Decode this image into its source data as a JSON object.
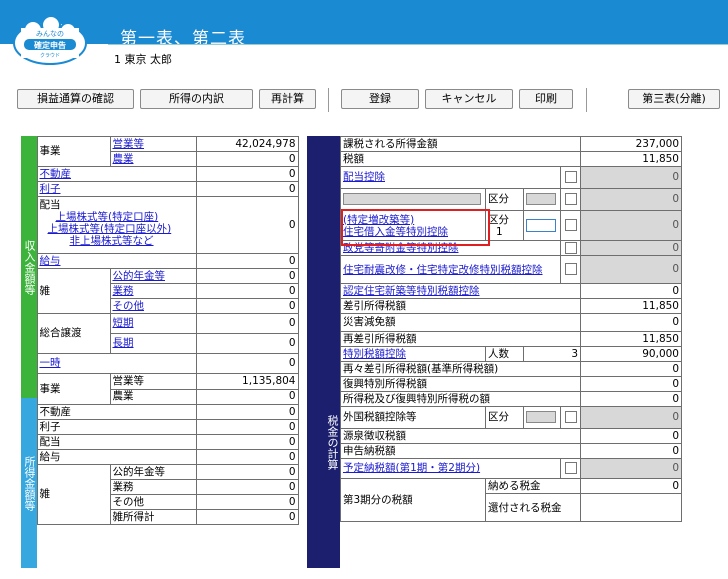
{
  "app": {
    "logo_line1": "みんなの",
    "logo_line2": "確定申告",
    "logo_line3": "クラウド",
    "title": "第一表、第二表",
    "user": "1 東京 太郎"
  },
  "toolbar": {
    "btn1": "損益通算の確認",
    "btn2": "所得の内訳",
    "btn3": "再計算",
    "btn4": "登録",
    "btn5": "キャンセル",
    "btn6": "印刷",
    "btn7": "第三表(分離)"
  },
  "side": {
    "income": "収入金額等",
    "shotoku": "所得金額等",
    "tax": "税金の計算"
  },
  "income": {
    "jigyo": "事業",
    "eigyo": "営業等",
    "eigyo_val": "42,024,978",
    "nogyo": "農業",
    "nogyo_val": "0",
    "fudosan": "不動産",
    "fudosan_val": "0",
    "rishi": "利子",
    "rishi_val": "0",
    "haito": "配当",
    "haito1": "上場株式等(特定口座)",
    "haito2": "上場株式等(特定口座以外)",
    "haito3": "非上場株式等など",
    "haito_val": "0",
    "kyuyo": "給与",
    "kyuyo_val": "0",
    "zatsu": "雑",
    "nenkin": "公的年金等",
    "nenkin_val": "0",
    "gyomu": "業務",
    "gyomu_val": "0",
    "sonota": "その他",
    "sonota_val": "0",
    "sogo": "総合譲渡",
    "tanki": "短期",
    "tanki_val": "0",
    "choki": "長期",
    "choki_val": "0",
    "ichiji": "一時",
    "ichiji_val": "0"
  },
  "shotoku": {
    "jigyo": "事業",
    "eigyo": "営業等",
    "eigyo_val": "1,135,804",
    "nogyo": "農業",
    "nogyo_val": "0",
    "fudosan": "不動産",
    "fudosan_val": "0",
    "rishi": "利子",
    "rishi_val": "0",
    "haito": "配当",
    "haito_val": "0",
    "kyuyo": "給与",
    "kyuyo_val": "0",
    "zatsu": "雑",
    "nenkin": "公的年金等",
    "nenkin_val": "0",
    "gyomu": "業務",
    "gyomu_val": "0",
    "sonota": "その他",
    "sonota_val": "0",
    "zatsu_kei": "雑所得計",
    "zatsu_kei_val": "0"
  },
  "tax": {
    "kazei": "課税される所得金額",
    "kazei_val": "237,000",
    "zeigaku": "税額",
    "zeigaku_val": "11,850",
    "haito_kojo": "配当控除",
    "haito_kojo_val": "0",
    "kubun": "区分",
    "blank_val": "0",
    "jutaku1": "(特定増改築等)",
    "jutaku2": "住宅借入金等特別控除",
    "jutaku_kubun_val": "1",
    "jutaku_val": "0",
    "seito": "政党等寄附金等特別控除",
    "seito_val": "0",
    "taishin": "住宅耐震改修・住宅特定改修特別税額控除",
    "taishin_val": "0",
    "nintei": "認定住宅新築等特別税額控除",
    "nintei_val": "0",
    "sashihiki": "差引所得税額",
    "sashihiki_val": "11,850",
    "saigai": "災害減免額",
    "saigai_val": "0",
    "sai_sashihiki": "再差引所得税額",
    "sai_sashihiki_val": "11,850",
    "tokubetsu": "特別税額控除",
    "ninzu": "人数",
    "ninzu_val": "3",
    "tokubetsu_val": "90,000",
    "saisai": "再々差引所得税額(基準所得税額)",
    "saisai_val": "0",
    "fukko": "復興特別所得税額",
    "fukko_val": "0",
    "shotoku_fukko": "所得税及び復興特別所得税の額",
    "shotoku_fukko_val": "0",
    "gaikoku": "外国税額控除等",
    "gaikoku_val": "0",
    "gensen": "源泉徴収税額",
    "gensen_val": "0",
    "shinkoku": "申告納税額",
    "shinkoku_val": "0",
    "yotei": "予定納税額(第1期・第2期分)",
    "yotei_val": "0",
    "dai3ki": "第3期分の税額",
    "osameru": "納める税金",
    "osameru_val": "0",
    "kanpu": "還付される税金"
  }
}
